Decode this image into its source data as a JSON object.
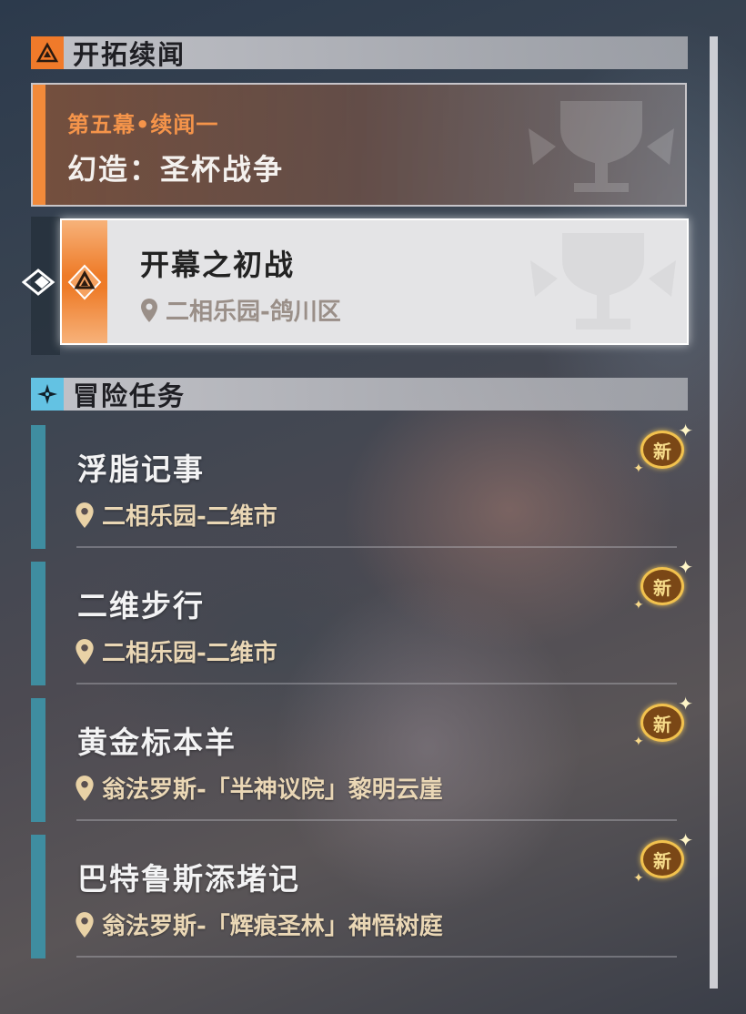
{
  "trailblaze_section": {
    "title": "开拓续闻",
    "chapter": {
      "subtitle": "第五幕•续闻一",
      "name": "幻造：圣杯战争"
    },
    "selected_mission": {
      "name": "开幕之初战",
      "location": "二相乐园-鸽川区"
    }
  },
  "adventure_section": {
    "title": "冒险任务",
    "quests": [
      {
        "name": "浮脂记事",
        "location": "二相乐园-二维市",
        "badge": "新"
      },
      {
        "name": "二维步行",
        "location": "二相乐园-二维市",
        "badge": "新"
      },
      {
        "name": "黄金标本羊",
        "location": "翁法罗斯-「半神议院」黎明云崖",
        "badge": "新"
      },
      {
        "name": "巴特鲁斯添堵记",
        "location": "翁法罗斯-「辉痕圣林」神悟树庭",
        "badge": "新"
      }
    ]
  },
  "colors": {
    "trailblaze_accent": "#f07a2a",
    "adventure_accent": "#63c2e3",
    "quest_bar": "#3f8da0",
    "badge_gold": "#f2c24e"
  },
  "icons": [
    "trailblaze-triangle-icon",
    "adventure-star-icon",
    "selector-arrow-icon",
    "location-pin-icon",
    "new-badge-icon",
    "grail-watermark-icon"
  ]
}
